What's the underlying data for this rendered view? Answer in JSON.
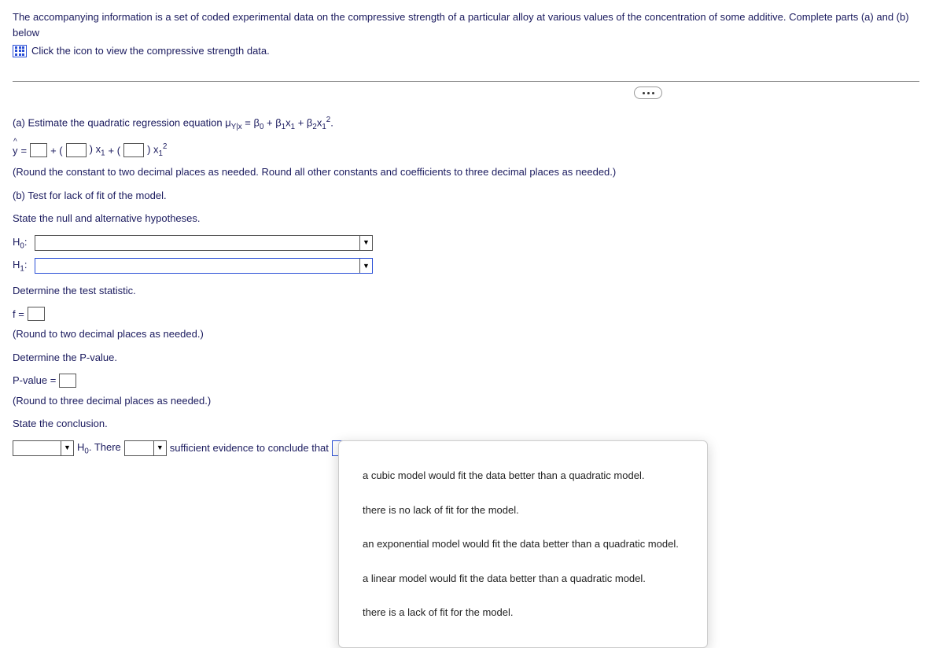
{
  "intro": "The accompanying information is a set of coded experimental data on the compressive strength of a particular alloy at various values of the concentration of some additive. Complete parts (a) and (b) below",
  "data_link": "Click the icon to view the compressive strength data.",
  "partA": {
    "prompt_lead": "(a) Estimate the quadratic regression equation ",
    "mu": "μ",
    "mu_sub": "Y|x",
    "equals": " = β",
    "b0sub": "0",
    "plus1": " + β",
    "b1sub": "1",
    "x1": "x",
    "x1sub": "1",
    "plus2": " + β",
    "b2sub": "2",
    "x2": "x",
    "x2subA": "1",
    "x2sup": "2",
    "period": ".",
    "yhat_line": {
      "y": "y",
      "eq": " = ",
      "plus1": " + (",
      "close1": ") x",
      "sub1": "1",
      "plus2": " + (",
      "close2": ") x",
      "sub2": "1",
      "sup2": "2"
    },
    "round_hint": "(Round the constant to two decimal places as needed. Round all other constants and coefficients to three decimal places as needed.)"
  },
  "partB": {
    "header": "(b) Test for lack of fit of the model.",
    "state_hyp": "State the null and alternative hypotheses.",
    "H0_label": "H",
    "H0_sub": "0",
    "H1_label": "H",
    "H1_sub": "1",
    "colon": ":",
    "det_stat": "Determine the test statistic.",
    "f_label": "f = ",
    "f_hint": "(Round to two decimal places as needed.)",
    "det_p": "Determine the P-value.",
    "p_label": "P-value = ",
    "p_hint": "(Round to three decimal places as needed.)",
    "state_conc": "State the conclusion."
  },
  "conclusion": {
    "h0_text": " H",
    "h0_sub": "0",
    "there": ". There ",
    "sufficient": " sufficient evidence to conclude that "
  },
  "dropdown_options": [
    "a cubic model would fit the data better than a quadratic model.",
    "there is no lack of fit for the model.",
    "an exponential model would fit the data better than a quadratic model.",
    "a linear model would fit the data better than a quadratic model.",
    "there is a lack of fit for the model."
  ]
}
